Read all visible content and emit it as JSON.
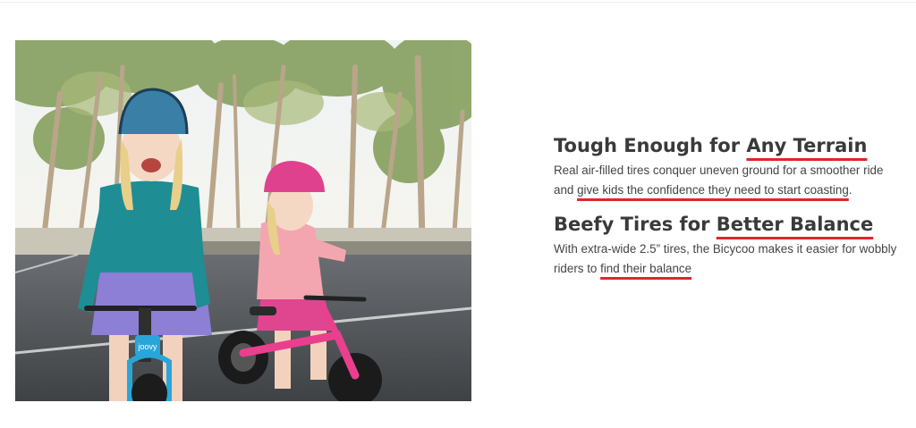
{
  "features": [
    {
      "heading_plain": "Tough Enough for ",
      "heading_highlight": "Any Terrain",
      "body_before": "Real air-filled tires conquer uneven ground for a smoother ride and ",
      "body_highlight": "give kids the confidence they need to start coasting",
      "body_after": "."
    },
    {
      "heading_plain": "Beefy Tires for ",
      "heading_highlight": "Better Balance",
      "body_before": "With extra-wide 2.5” tires, the Bicycoo makes it easier for wobbly riders to ",
      "body_highlight": "find their balance",
      "body_after": ""
    }
  ],
  "photo": {
    "subject": "kids-on-balance-bikes-photo",
    "bike_logo_text": "joovy"
  },
  "colors": {
    "underline_accent": "#e0262b",
    "heading_text": "#3a3a3a",
    "body_text": "#444444"
  }
}
